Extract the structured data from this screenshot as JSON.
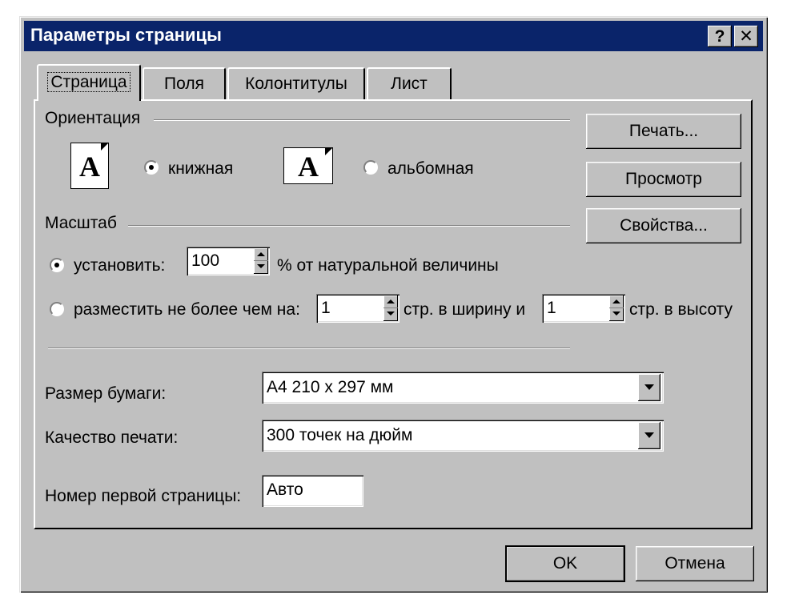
{
  "window": {
    "title": "Параметры страницы",
    "help_label": "?",
    "close_label": "✕"
  },
  "tabs": [
    {
      "label": "Страница",
      "active": true
    },
    {
      "label": "Поля"
    },
    {
      "label": "Колонтитулы"
    },
    {
      "label": "Лист"
    }
  ],
  "orientation": {
    "group_label": "Ориентация",
    "portrait_label": "книжная",
    "landscape_label": "альбомная",
    "selected": "portrait",
    "icon_glyph": "A"
  },
  "scale": {
    "group_label": "Масштаб",
    "set_label": "установить:",
    "set_value": "100",
    "set_suffix": "% от натуральной величины",
    "fit_label": "разместить не более чем на:",
    "fit_width_value": "1",
    "fit_width_suffix": "стр. в ширину и",
    "fit_height_value": "1",
    "fit_height_suffix": "стр. в высоту",
    "selected": "set"
  },
  "paper": {
    "size_label": "Размер бумаги:",
    "size_value": "A4 210 x 297 мм",
    "quality_label": "Качество печати:",
    "quality_value": "300 точек на дюйм",
    "first_page_label": "Номер первой страницы:",
    "first_page_value": "Авто"
  },
  "buttons": {
    "print": "Печать...",
    "preview": "Просмотр",
    "properties": "Свойства...",
    "ok": "OK",
    "cancel": "Отмена"
  }
}
